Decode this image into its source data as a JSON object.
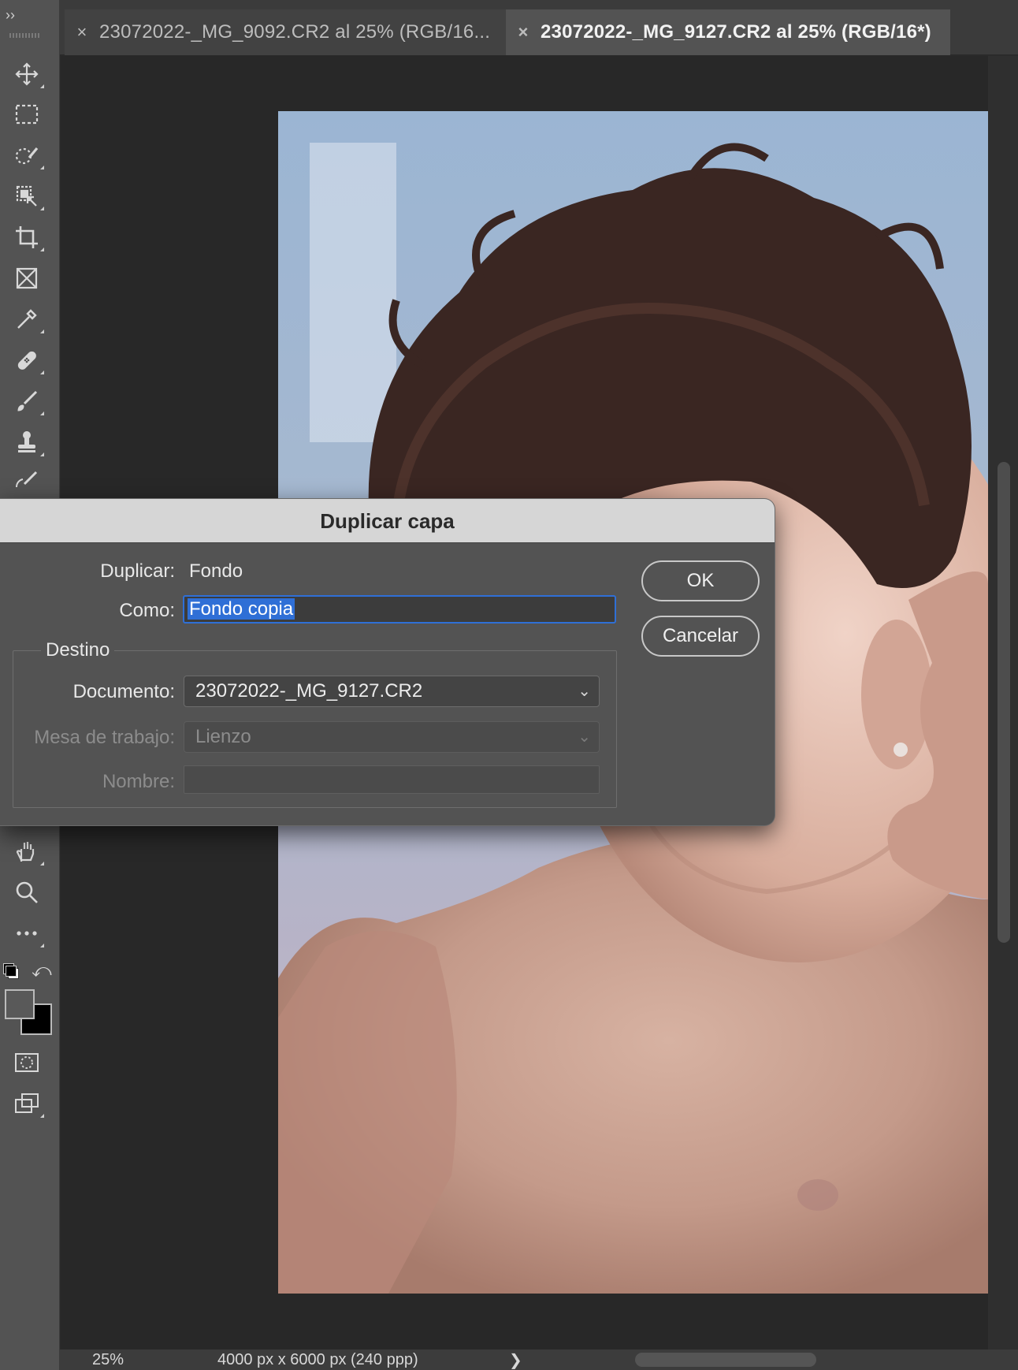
{
  "tabs": [
    {
      "label": "23072022-_MG_9092.CR2 al 25% (RGB/16...",
      "close": "×",
      "active": false
    },
    {
      "label": "23072022-_MG_9127.CR2 al 25% (RGB/16*)",
      "close": "×",
      "active": true
    }
  ],
  "toolbar": {
    "collapse": "››",
    "tools": [
      "move-icon",
      "marquee-icon",
      "quick-selection-icon",
      "object-selection-icon",
      "crop-icon",
      "frame-icon",
      "eyedropper-icon",
      "healing-brush-icon",
      "brush-icon",
      "clone-stamp-icon",
      "history-brush-icon",
      "hand-icon",
      "zoom-icon",
      "more-tools-icon",
      "default-colors-icon",
      "swap-colors-icon",
      "foreground-background-icon",
      "quick-mask-icon",
      "screen-mode-icon"
    ],
    "foreground_color": "#595959",
    "background_color": "#000000"
  },
  "dialog": {
    "title": "Duplicar capa",
    "duplicar_label": "Duplicar:",
    "duplicar_value": "Fondo",
    "como_label": "Como:",
    "como_value": "Fondo copia",
    "destino_label": "Destino",
    "documento_label": "Documento:",
    "documento_value": "23072022-_MG_9127.CR2",
    "mesa_label": "Mesa de trabajo:",
    "mesa_value": "Lienzo",
    "nombre_label": "Nombre:",
    "nombre_value": "",
    "ok": "OK",
    "cancel": "Cancelar"
  },
  "status": {
    "zoom": "25%",
    "doc_info": "4000 px x 6000 px (240 ppp)",
    "arrow": "❯"
  },
  "colors": {
    "accent": "#2f6fd6",
    "panel": "#535353",
    "canvas_bg": "#282828"
  }
}
